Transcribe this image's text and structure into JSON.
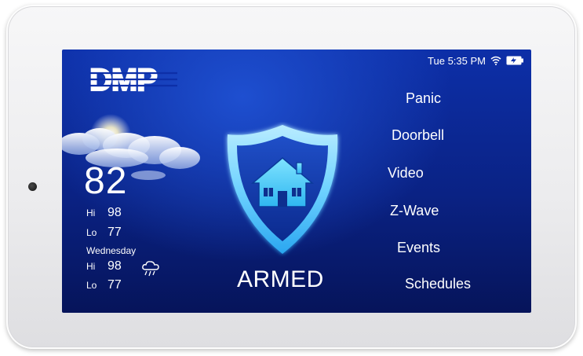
{
  "status": {
    "time": "Tue 5:35 PM",
    "icons": [
      "wifi-icon",
      "battery-charging-icon"
    ]
  },
  "brand": {
    "logo_text": "DMP"
  },
  "weather": {
    "current_temp": "82",
    "today": {
      "hi_label": "Hi",
      "hi": "98",
      "lo_label": "Lo",
      "lo": "77"
    },
    "forecast": {
      "day": "Wednesday",
      "hi_label": "Hi",
      "hi": "98",
      "lo_label": "Lo",
      "lo": "77",
      "icon": "rain-cloud-icon"
    }
  },
  "arm_status": {
    "label": "ARMED",
    "icon": "house-shield-icon"
  },
  "menu": {
    "items": [
      {
        "label": "Panic"
      },
      {
        "label": "Doorbell"
      },
      {
        "label": "Video"
      },
      {
        "label": "Z-Wave"
      },
      {
        "label": "Events"
      },
      {
        "label": "Schedules"
      }
    ]
  },
  "colors": {
    "screen_top": "#0d2fa8",
    "screen_bottom": "#06145a",
    "shield_glow": "#5fd0ff",
    "text": "#ffffff"
  }
}
